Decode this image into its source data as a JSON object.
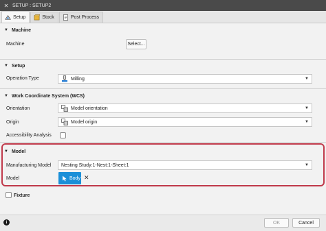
{
  "window": {
    "title": "SETUP : SETUP2"
  },
  "tabs": [
    {
      "label": "Setup",
      "icon": "setup-icon"
    },
    {
      "label": "Stock",
      "icon": "stock-icon"
    },
    {
      "label": "Post Process",
      "icon": "post-process-icon"
    }
  ],
  "machine": {
    "heading": "Machine",
    "label": "Machine",
    "button": "Select..."
  },
  "setup": {
    "heading": "Setup",
    "operation_type_label": "Operation Type",
    "operation_type_value": "Milling"
  },
  "wcs": {
    "heading": "Work Coordinate System (WCS)",
    "orientation_label": "Orientation",
    "orientation_value": "Model orientation",
    "origin_label": "Origin",
    "origin_value": "Model origin",
    "accessibility_label": "Accessibility Analysis"
  },
  "model": {
    "heading": "Model",
    "manufacturing_model_label": "Manufacturing Model",
    "manufacturing_model_value": "Nesting Study:1-Nest:1-Sheet:1",
    "model_label": "Model",
    "body_chip": "Body",
    "highlight_color": "#c0394a",
    "chip_color": "#1a8fd8"
  },
  "fixture": {
    "heading": "Fixture"
  },
  "footer": {
    "ok": "OK",
    "cancel": "Cancel"
  }
}
